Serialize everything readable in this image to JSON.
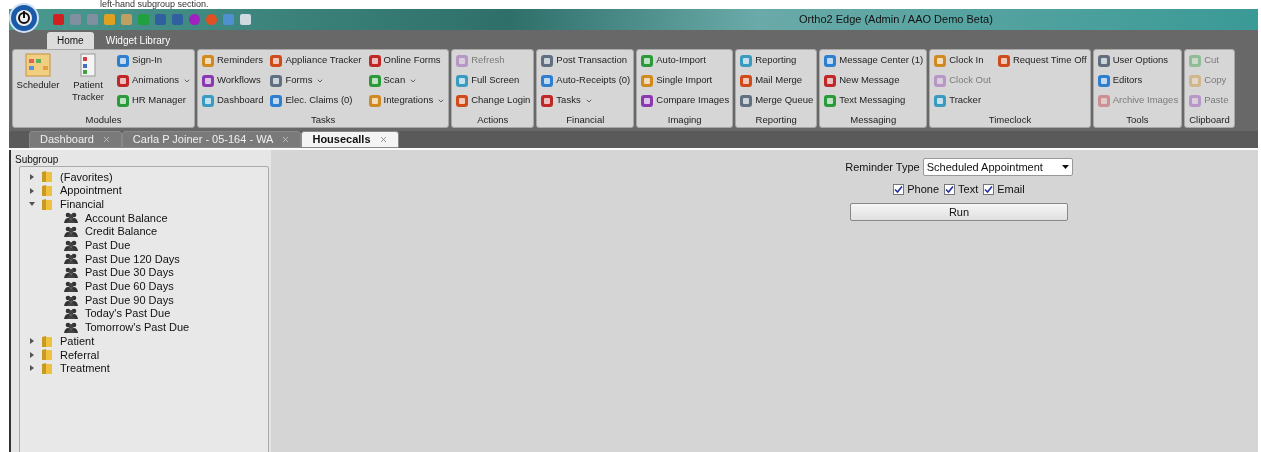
{
  "caption": "left-hand subgroup section.",
  "window": {
    "title": "Ortho2 Edge (Admin / AAO Demo Beta)"
  },
  "ribbon_tabs": [
    {
      "label": "Home",
      "selected": true
    },
    {
      "label": "Widget Library",
      "selected": false
    }
  ],
  "ribbon_groups": [
    {
      "label": "Modules",
      "large": [
        {
          "label": "Scheduler"
        },
        {
          "label": "Patient Tracker"
        }
      ],
      "columns": [
        [
          {
            "label": "Sign-In",
            "disabled": false,
            "dropdown": false
          },
          {
            "label": "Animations",
            "disabled": false,
            "dropdown": true
          },
          {
            "label": "HR Manager",
            "disabled": false,
            "dropdown": false
          }
        ]
      ]
    },
    {
      "label": "Tasks",
      "columns": [
        [
          {
            "label": "Reminders",
            "disabled": false,
            "dropdown": false
          },
          {
            "label": "Workflows",
            "disabled": false,
            "dropdown": false
          },
          {
            "label": "Dashboard",
            "disabled": false,
            "dropdown": false
          }
        ],
        [
          {
            "label": "Appliance Tracker",
            "disabled": false,
            "dropdown": false
          },
          {
            "label": "Forms",
            "disabled": false,
            "dropdown": true
          },
          {
            "label": "Elec. Claims (0)",
            "disabled": false,
            "dropdown": false
          }
        ],
        [
          {
            "label": "Online Forms",
            "disabled": false,
            "dropdown": false
          },
          {
            "label": "Scan",
            "disabled": false,
            "dropdown": true
          },
          {
            "label": "Integrations",
            "disabled": false,
            "dropdown": true
          }
        ]
      ]
    },
    {
      "label": "Actions",
      "columns": [
        [
          {
            "label": "Refresh",
            "disabled": true,
            "dropdown": false
          },
          {
            "label": "Full Screen",
            "disabled": false,
            "dropdown": false
          },
          {
            "label": "Change Login",
            "disabled": false,
            "dropdown": false
          }
        ]
      ]
    },
    {
      "label": "Financial",
      "columns": [
        [
          {
            "label": "Post Transaction",
            "disabled": false,
            "dropdown": false
          },
          {
            "label": "Auto-Receipts (0)",
            "disabled": false,
            "dropdown": false
          },
          {
            "label": "Tasks",
            "disabled": false,
            "dropdown": true
          }
        ]
      ]
    },
    {
      "label": "Imaging",
      "columns": [
        [
          {
            "label": "Auto-Import",
            "disabled": false,
            "dropdown": false
          },
          {
            "label": "Single Import",
            "disabled": false,
            "dropdown": false
          },
          {
            "label": "Compare Images",
            "disabled": false,
            "dropdown": false
          }
        ]
      ]
    },
    {
      "label": "Reporting",
      "columns": [
        [
          {
            "label": "Reporting",
            "disabled": false,
            "dropdown": false
          },
          {
            "label": "Mail Merge",
            "disabled": false,
            "dropdown": false
          },
          {
            "label": "Merge Queue",
            "disabled": false,
            "dropdown": false
          }
        ]
      ]
    },
    {
      "label": "Messaging",
      "columns": [
        [
          {
            "label": "Message Center (1)",
            "disabled": false,
            "dropdown": false
          },
          {
            "label": "New Message",
            "disabled": false,
            "dropdown": false
          },
          {
            "label": "Text Messaging",
            "disabled": false,
            "dropdown": false
          }
        ]
      ]
    },
    {
      "label": "Timeclock",
      "columns": [
        [
          {
            "label": "Clock In",
            "disabled": false,
            "dropdown": false
          },
          {
            "label": "Clock Out",
            "disabled": true,
            "dropdown": false
          },
          {
            "label": "Tracker",
            "disabled": false,
            "dropdown": false
          }
        ],
        [
          {
            "label": "Request Time Off",
            "disabled": false,
            "dropdown": false
          }
        ]
      ]
    },
    {
      "label": "Tools",
      "columns": [
        [
          {
            "label": "User Options",
            "disabled": false,
            "dropdown": false
          },
          {
            "label": "Editors",
            "disabled": false,
            "dropdown": false
          },
          {
            "label": "Archive Images",
            "disabled": true,
            "dropdown": false
          }
        ]
      ]
    },
    {
      "label": "Clipboard",
      "columns": [
        [
          {
            "label": "Cut",
            "disabled": true,
            "dropdown": false
          },
          {
            "label": "Copy",
            "disabled": true,
            "dropdown": false
          },
          {
            "label": "Paste",
            "disabled": true,
            "dropdown": false
          }
        ]
      ]
    }
  ],
  "document_tabs": [
    {
      "label": "Dashboard",
      "selected": false
    },
    {
      "label": "Carla P Joiner - 05-164 - WA",
      "selected": false
    },
    {
      "label": "Housecalls",
      "selected": true
    }
  ],
  "subgroup": {
    "title": "Subgroup",
    "tree": [
      {
        "kind": "folder",
        "label": "(Favorites)",
        "expanded": false
      },
      {
        "kind": "folder",
        "label": "Appointment",
        "expanded": false
      },
      {
        "kind": "folder",
        "label": "Financial",
        "expanded": true,
        "children": [
          {
            "kind": "group",
            "label": "Account Balance"
          },
          {
            "kind": "group",
            "label": "Credit Balance"
          },
          {
            "kind": "group",
            "label": "Past Due"
          },
          {
            "kind": "group",
            "label": "Past Due 120 Days"
          },
          {
            "kind": "group",
            "label": "Past Due 30 Days"
          },
          {
            "kind": "group",
            "label": "Past Due 60 Days"
          },
          {
            "kind": "group",
            "label": "Past Due 90 Days"
          },
          {
            "kind": "group",
            "label": "Today's Past Due"
          },
          {
            "kind": "group",
            "label": "Tomorrow's Past Due"
          }
        ]
      },
      {
        "kind": "folder",
        "label": "Patient",
        "expanded": false
      },
      {
        "kind": "folder",
        "label": "Referral",
        "expanded": false
      },
      {
        "kind": "folder",
        "label": "Treatment",
        "expanded": false
      }
    ]
  },
  "reminder": {
    "label": "Reminder Type",
    "value": "Scheduled Appointment",
    "options": [
      {
        "label": "Phone",
        "checked": true
      },
      {
        "label": "Text",
        "checked": true
      },
      {
        "label": "Email",
        "checked": true
      }
    ],
    "run_button": "Run"
  }
}
